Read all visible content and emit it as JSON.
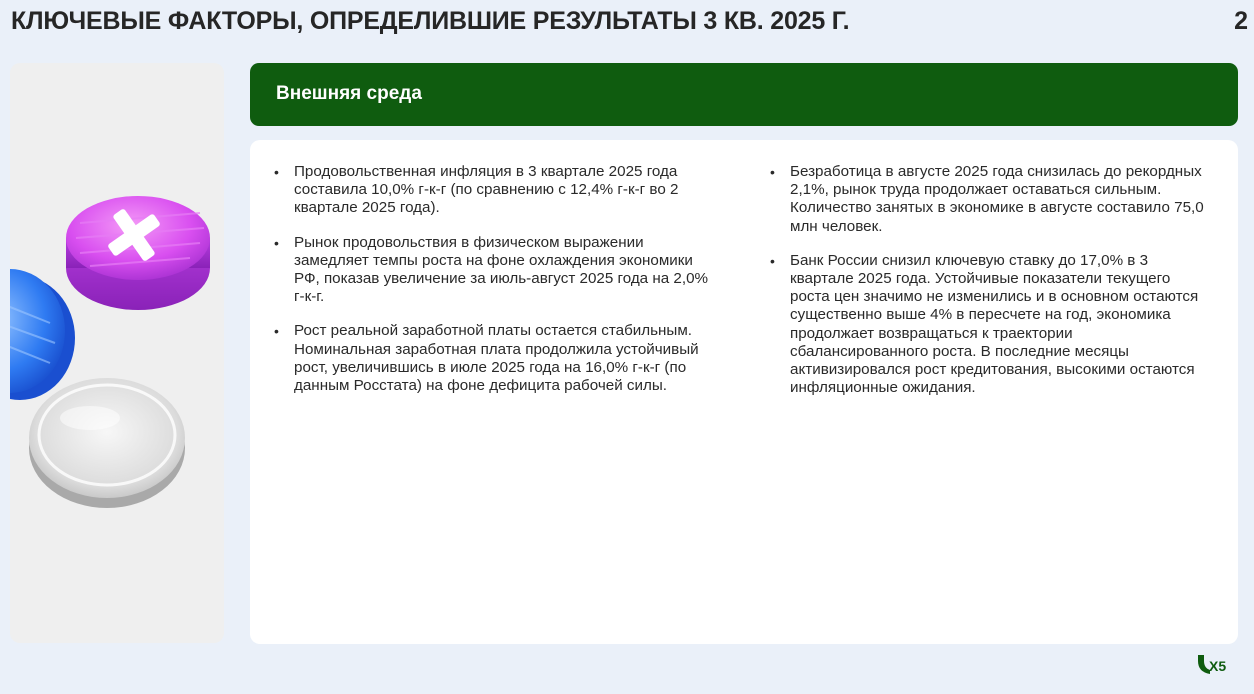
{
  "header": {
    "title": "КЛЮЧЕВЫЕ ФАКТОРЫ, ОПРЕДЕЛИВШИЕ РЕЗУЛЬТАТЫ 3 КВ. 2025 Г.",
    "page_number": "2"
  },
  "section": {
    "title": "Внешняя среда"
  },
  "bullets_left": [
    "Продовольственная инфляция в 3 квартале 2025 года составила 10,0% г-к-г (по сравнению с 12,4% г-к-г во 2 квартале 2025 года).",
    "Рынок продовольствия в физическом выражении замедляет темпы роста на фоне охлаждения экономики РФ, показав увеличение за июль-август 2025 года на 2,0% г-к-г.",
    "Рост реальной заработной платы остается стабильным. Номинальная заработная плата продолжила устойчивый рост, увеличившись в июле 2025 года на 16,0% г-к-г (по данным Росстата) на фоне дефицита рабочей силы."
  ],
  "bullets_right": [
    "Безработица в августе 2025 года снизилась до рекордных 2,1%, рынок труда продолжает оставаться сильным. Количество занятых в экономике в августе составило 75,0 млн человек.",
    "Банк России снизил ключевую ставку до 17,0% в 3 квартале 2025 года. Устойчивые показатели текущего роста цен значимо не изменились и в основном остаются существенно выше 4% в пересчете на год, экономика продолжает возвращаться к траектории сбалансированного роста. В последние месяцы активизировался рост кредитования, высокими остаются инфляционные ожидания."
  ],
  "logo": {
    "text": "X5",
    "color": "#0f5c0f"
  },
  "colors": {
    "header_green": "#0f5c0f",
    "background": "#eaf0f9",
    "magenta_disc": "#d94ff0",
    "blue_disc": "#2f7bf2"
  }
}
